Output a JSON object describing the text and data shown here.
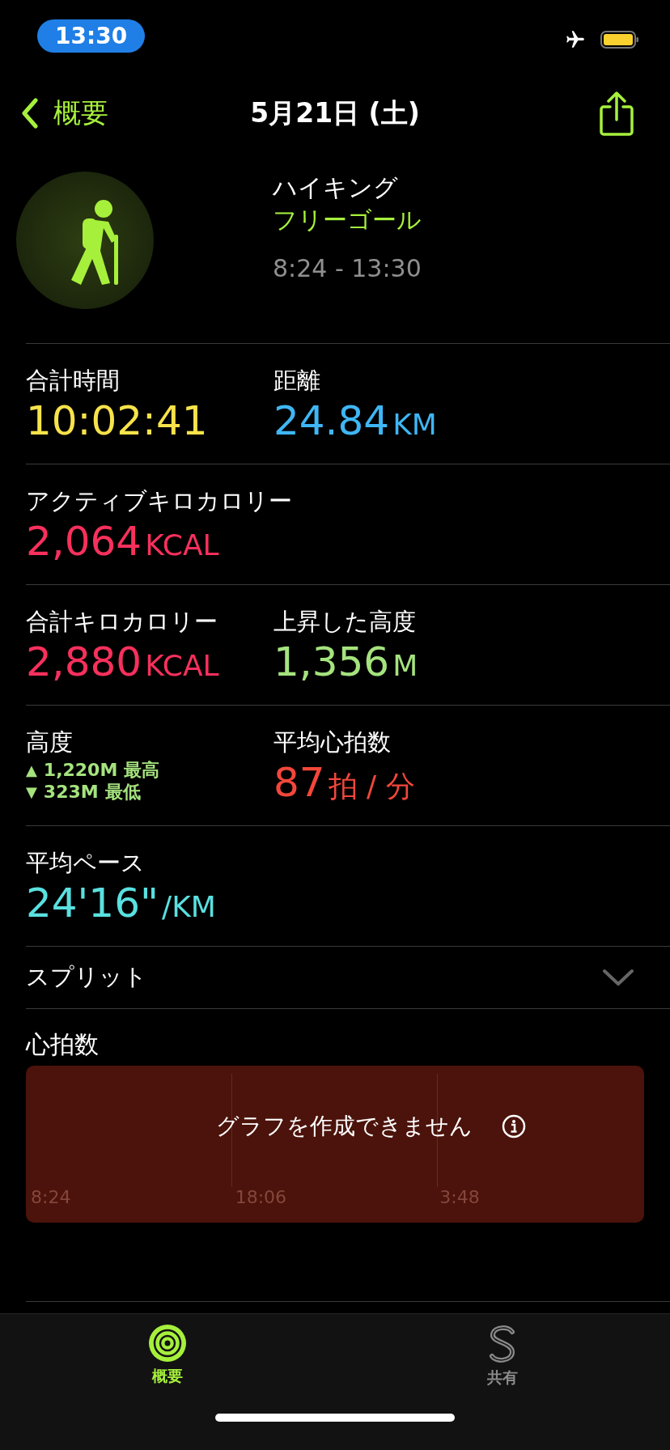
{
  "status_bar": {
    "time": "13:30"
  },
  "nav": {
    "back": "概要",
    "title": "5月21日 (土)"
  },
  "workout": {
    "name": "ハイキング",
    "goal": "フリーゴール",
    "time_range": "8:24 - 13:30"
  },
  "metric_rows": [
    [
      {
        "kind": "value",
        "label": "合計時間",
        "value": "10:02:41",
        "color": "#f7e34a"
      },
      {
        "kind": "value",
        "label": "距離",
        "value": "24.84",
        "unit": "KM",
        "color": "#3fb6f5"
      }
    ],
    [
      {
        "kind": "value",
        "label": "アクティブキロカロリー",
        "value": "2,064",
        "unit": "KCAL",
        "color": "#f7305c"
      }
    ],
    [
      {
        "kind": "value",
        "label": "合計キロカロリー",
        "value": "2,880",
        "unit": "KCAL",
        "color": "#f7305c"
      },
      {
        "kind": "value",
        "label": "上昇した高度",
        "value": "1,356",
        "unit": "M",
        "color": "#a5e37e"
      }
    ],
    [
      {
        "kind": "range",
        "label": "高度",
        "color": "#a5e37e",
        "lines": [
          {
            "arrow": "▲",
            "value": "1,220M",
            "note": "最高"
          },
          {
            "arrow": "▼",
            "value": "323M",
            "note": "最低"
          }
        ]
      },
      {
        "kind": "value",
        "label": "平均心拍数",
        "value": "87",
        "unit": "拍 / 分",
        "color": "#f2473a"
      }
    ],
    [
      {
        "kind": "value",
        "label": "平均ペース",
        "value": "24'16\"",
        "unit": "/KM",
        "color": "#5ae0e0"
      }
    ]
  ],
  "splits": {
    "label": "スプリット"
  },
  "heart_rate": {
    "title": "心拍数",
    "message": "グラフを作成できません",
    "time_labels": [
      "8:24",
      "18:06",
      "3:48"
    ]
  },
  "tabs": [
    {
      "kind": "summary",
      "label": "概要",
      "selected": true
    },
    {
      "kind": "sharing",
      "label": "共有",
      "selected": false
    }
  ]
}
